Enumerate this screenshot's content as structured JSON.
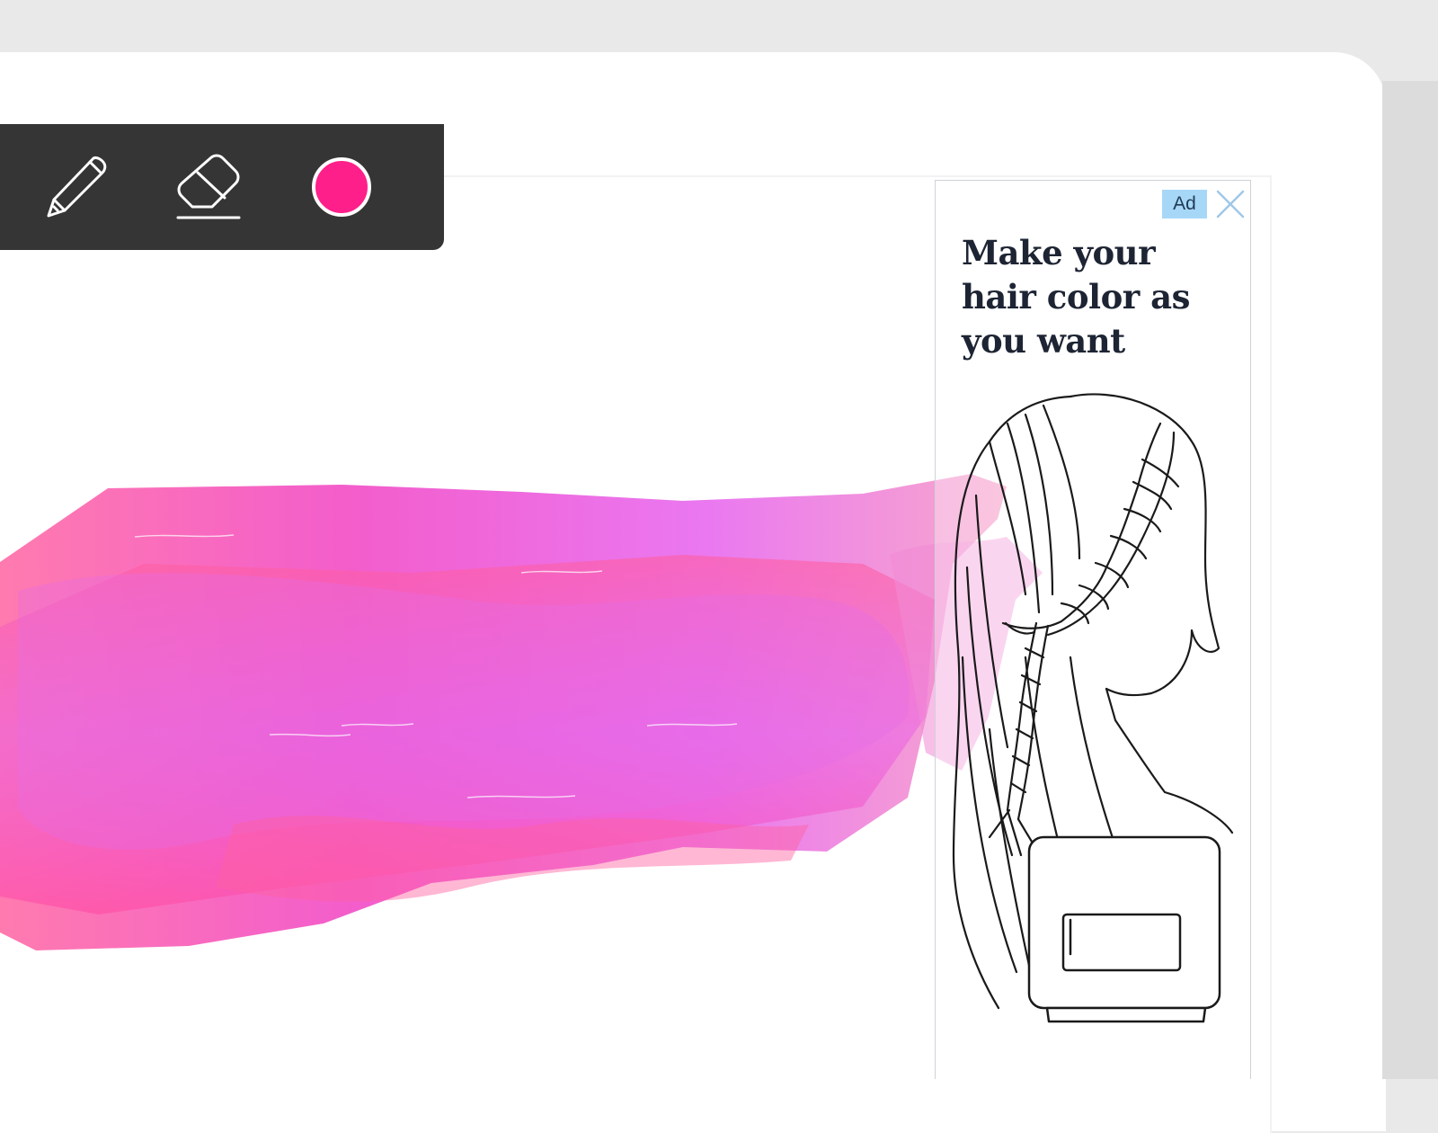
{
  "toolbar": {
    "tools": [
      {
        "name": "pencil",
        "icon": "pencil-icon"
      },
      {
        "name": "eraser",
        "icon": "eraser-icon"
      },
      {
        "name": "color",
        "icon": "color-swatch"
      }
    ],
    "selected_color": "#ff1f8a",
    "background": "#353535"
  },
  "canvas": {
    "stroke_colors": [
      "#ff6fa8",
      "#f24fc7",
      "#e86cf0",
      "#ff4fa6",
      "#f7a0c8"
    ]
  },
  "ad": {
    "badge": "Ad",
    "headline": "Make your hair color as you want",
    "close_icon": "close-icon",
    "badge_color": "#a7d7f7"
  }
}
